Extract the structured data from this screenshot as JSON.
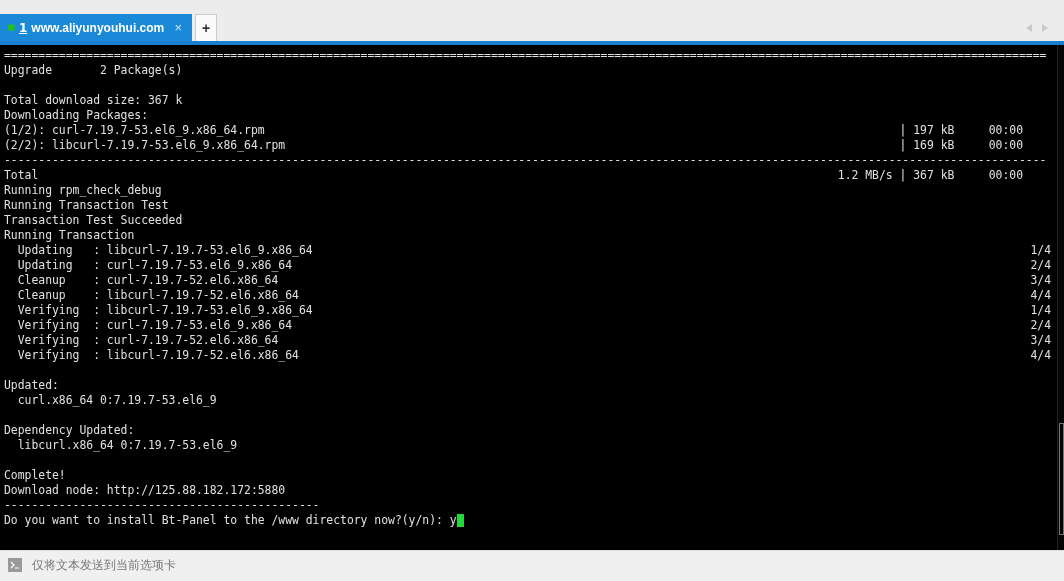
{
  "tabs": [
    {
      "index": "1",
      "title": "www.aliyunyouhui.com",
      "selected": true,
      "connected": true,
      "close": "×"
    }
  ],
  "new_tab": "+",
  "terminal": {
    "lines": [
      {
        "kind": "rule",
        "text": "========================================================================================================================================================"
      },
      {
        "kind": "text",
        "text": "Upgrade       2 Package(s)"
      },
      {
        "kind": "blank"
      },
      {
        "kind": "text",
        "text": "Total download size: 367 k"
      },
      {
        "kind": "text",
        "text": "Downloading Packages:"
      },
      {
        "kind": "transfer",
        "text": "(1/2): curl-7.19.7-53.el6_9.x86_64.rpm",
        "right": "| 197 kB     00:00"
      },
      {
        "kind": "transfer",
        "text": "(2/2): libcurl-7.19.7-53.el6_9.x86_64.rpm",
        "right": "| 169 kB     00:00"
      },
      {
        "kind": "rule",
        "text": "--------------------------------------------------------------------------------------------------------------------------------------------------------"
      },
      {
        "kind": "transfer",
        "text": "Total",
        "right": "1.2 MB/s | 367 kB     00:00"
      },
      {
        "kind": "text",
        "text": "Running rpm_check_debug"
      },
      {
        "kind": "text",
        "text": "Running Transaction Test"
      },
      {
        "kind": "text",
        "text": "Transaction Test Succeeded"
      },
      {
        "kind": "text",
        "text": "Running Transaction"
      },
      {
        "kind": "step",
        "text": "  Updating   : libcurl-7.19.7-53.el6_9.x86_64",
        "right": "1/4"
      },
      {
        "kind": "step",
        "text": "  Updating   : curl-7.19.7-53.el6_9.x86_64",
        "right": "2/4"
      },
      {
        "kind": "step",
        "text": "  Cleanup    : curl-7.19.7-52.el6.x86_64",
        "right": "3/4"
      },
      {
        "kind": "step",
        "text": "  Cleanup    : libcurl-7.19.7-52.el6.x86_64",
        "right": "4/4"
      },
      {
        "kind": "step",
        "text": "  Verifying  : libcurl-7.19.7-53.el6_9.x86_64",
        "right": "1/4"
      },
      {
        "kind": "step",
        "text": "  Verifying  : curl-7.19.7-53.el6_9.x86_64",
        "right": "2/4"
      },
      {
        "kind": "step",
        "text": "  Verifying  : curl-7.19.7-52.el6.x86_64",
        "right": "3/4"
      },
      {
        "kind": "step",
        "text": "  Verifying  : libcurl-7.19.7-52.el6.x86_64",
        "right": "4/4"
      },
      {
        "kind": "blank"
      },
      {
        "kind": "text",
        "text": "Updated:"
      },
      {
        "kind": "text",
        "text": "  curl.x86_64 0:7.19.7-53.el6_9"
      },
      {
        "kind": "blank"
      },
      {
        "kind": "text",
        "text": "Dependency Updated:"
      },
      {
        "kind": "text",
        "text": "  libcurl.x86_64 0:7.19.7-53.el6_9"
      },
      {
        "kind": "blank"
      },
      {
        "kind": "text",
        "text": "Complete!"
      },
      {
        "kind": "text",
        "text": "Download node: http://125.88.182.172:5880"
      },
      {
        "kind": "rule",
        "text": "----------------------------------------------"
      },
      {
        "kind": "prompt",
        "text": "Do you want to install Bt-Panel to the /www directory now?(y/n): y",
        "cursor": true
      }
    ]
  },
  "send_bar": {
    "placeholder": "仅将文本发送到当前选项卡"
  }
}
